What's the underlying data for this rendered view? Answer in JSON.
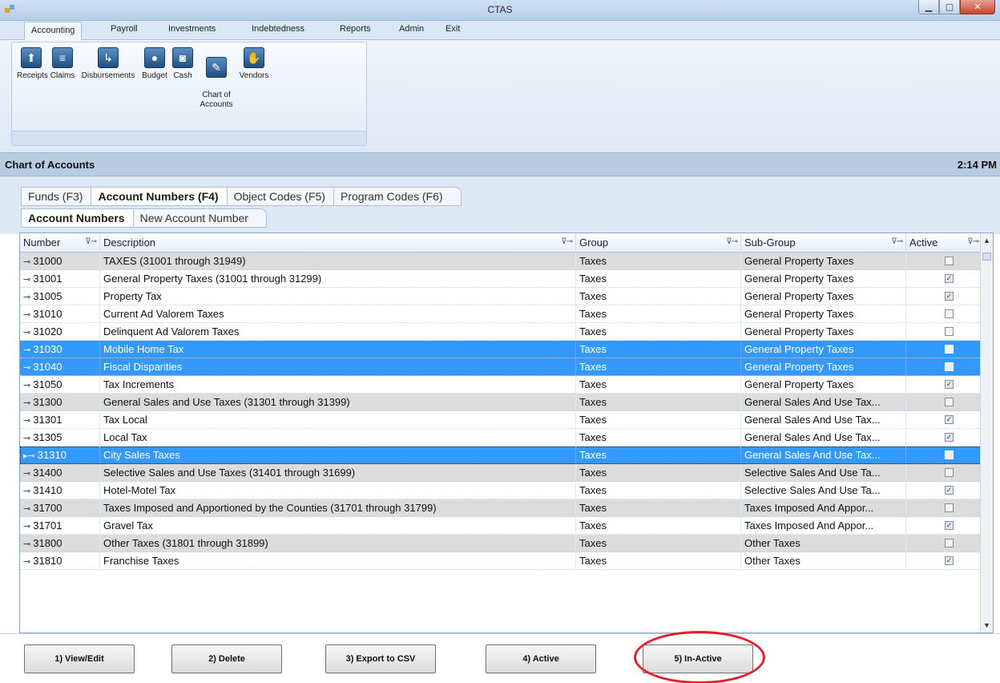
{
  "window": {
    "title": "CTAS"
  },
  "ribbon": {
    "tabs": [
      "Accounting",
      "Payroll",
      "Investments",
      "Indebtedness",
      "Reports",
      "Admin",
      "Exit"
    ],
    "buttons": [
      {
        "label": "Receipts",
        "icon": "receipts-icon",
        "glyph": "⬆"
      },
      {
        "label": "Claims",
        "icon": "claims-icon",
        "glyph": "≡"
      },
      {
        "label": "Disbursements",
        "icon": "disbursements-icon",
        "glyph": "↳"
      },
      {
        "label": "Budget",
        "icon": "budget-icon",
        "glyph": "●"
      },
      {
        "label": "Cash",
        "icon": "cash-icon",
        "glyph": "◙"
      },
      {
        "label": "Chart of\nAccounts",
        "icon": "chart-of-accounts-icon",
        "glyph": "✎"
      },
      {
        "label": "Vendors",
        "icon": "vendors-icon",
        "glyph": "✋"
      }
    ]
  },
  "section": {
    "title": "Chart of Accounts",
    "time": "2:14 PM"
  },
  "tabs_primary": [
    "Funds (F3)",
    "Account Numbers (F4)",
    "Object Codes (F5)",
    "Program Codes (F6)"
  ],
  "tabs_secondary": [
    "Account Numbers",
    "New Account Number"
  ],
  "grid": {
    "columns": [
      "Number",
      "Description",
      "Group",
      "Sub-Group",
      "Active"
    ],
    "rows": [
      {
        "number": "31000",
        "description": "TAXES (31001 through 31949)",
        "group": "Taxes",
        "subgroup": "General Property Taxes",
        "active": false,
        "kind": "group"
      },
      {
        "number": "31001",
        "description": "General Property Taxes (31001 through 31299)",
        "group": "Taxes",
        "subgroup": "General Property Taxes",
        "active": true,
        "kind": "normal"
      },
      {
        "number": "31005",
        "description": "Property Tax",
        "group": "Taxes",
        "subgroup": "General Property Taxes",
        "active": true,
        "kind": "normal"
      },
      {
        "number": "31010",
        "description": "Current Ad Valorem Taxes",
        "group": "Taxes",
        "subgroup": "General Property Taxes",
        "active": false,
        "kind": "normal"
      },
      {
        "number": "31020",
        "description": "Delinquent Ad Valorem Taxes",
        "group": "Taxes",
        "subgroup": "General Property Taxes",
        "active": false,
        "kind": "normal"
      },
      {
        "number": "31030",
        "description": "Mobile Home Tax",
        "group": "Taxes",
        "subgroup": "General Property Taxes",
        "active": false,
        "kind": "sel"
      },
      {
        "number": "31040",
        "description": "Fiscal Disparities",
        "group": "Taxes",
        "subgroup": "General Property Taxes",
        "active": false,
        "kind": "sel"
      },
      {
        "number": "31050",
        "description": "Tax Increments",
        "group": "Taxes",
        "subgroup": "General Property Taxes",
        "active": true,
        "kind": "normal"
      },
      {
        "number": "31300",
        "description": "General Sales and Use Taxes (31301 through 31399)",
        "group": "Taxes",
        "subgroup": "General Sales And Use Tax...",
        "active": false,
        "kind": "group"
      },
      {
        "number": "31301",
        "description": "Tax Local",
        "group": "Taxes",
        "subgroup": "General Sales And Use Tax...",
        "active": true,
        "kind": "normal"
      },
      {
        "number": "31305",
        "description": "Local Tax",
        "group": "Taxes",
        "subgroup": "General Sales And Use Tax...",
        "active": true,
        "kind": "normal"
      },
      {
        "number": "31310",
        "description": "City Sales Taxes",
        "group": "Taxes",
        "subgroup": "General Sales And Use Tax...",
        "active": false,
        "kind": "sel-current"
      },
      {
        "number": "31400",
        "description": "Selective Sales and Use Taxes (31401 through 31699)",
        "group": "Taxes",
        "subgroup": "Selective Sales And Use Ta...",
        "active": false,
        "kind": "group"
      },
      {
        "number": "31410",
        "description": "Hotel-Motel Tax",
        "group": "Taxes",
        "subgroup": "Selective Sales And Use Ta...",
        "active": true,
        "kind": "normal"
      },
      {
        "number": "31700",
        "description": "Taxes Imposed and Apportioned by the Counties (31701 through 31799)",
        "group": "Taxes",
        "subgroup": "Taxes Imposed And Appor...",
        "active": false,
        "kind": "group"
      },
      {
        "number": "31701",
        "description": "Gravel Tax",
        "group": "Taxes",
        "subgroup": "Taxes Imposed And Appor...",
        "active": true,
        "kind": "normal"
      },
      {
        "number": "31800",
        "description": "Other Taxes (31801 through 31899)",
        "group": "Taxes",
        "subgroup": "Other Taxes",
        "active": false,
        "kind": "group"
      },
      {
        "number": "31810",
        "description": "Franchise Taxes",
        "group": "Taxes",
        "subgroup": "Other Taxes",
        "active": true,
        "kind": "normal"
      }
    ]
  },
  "buttons": {
    "view_edit": "1) View/Edit",
    "delete": "2) Delete",
    "export": "3) Export to CSV",
    "active": "4) Active",
    "inactive": "5) In-Active"
  },
  "colors": {
    "selection": "#3399ff",
    "group_row": "#dcdcdc",
    "annotation": "#e3202a"
  }
}
